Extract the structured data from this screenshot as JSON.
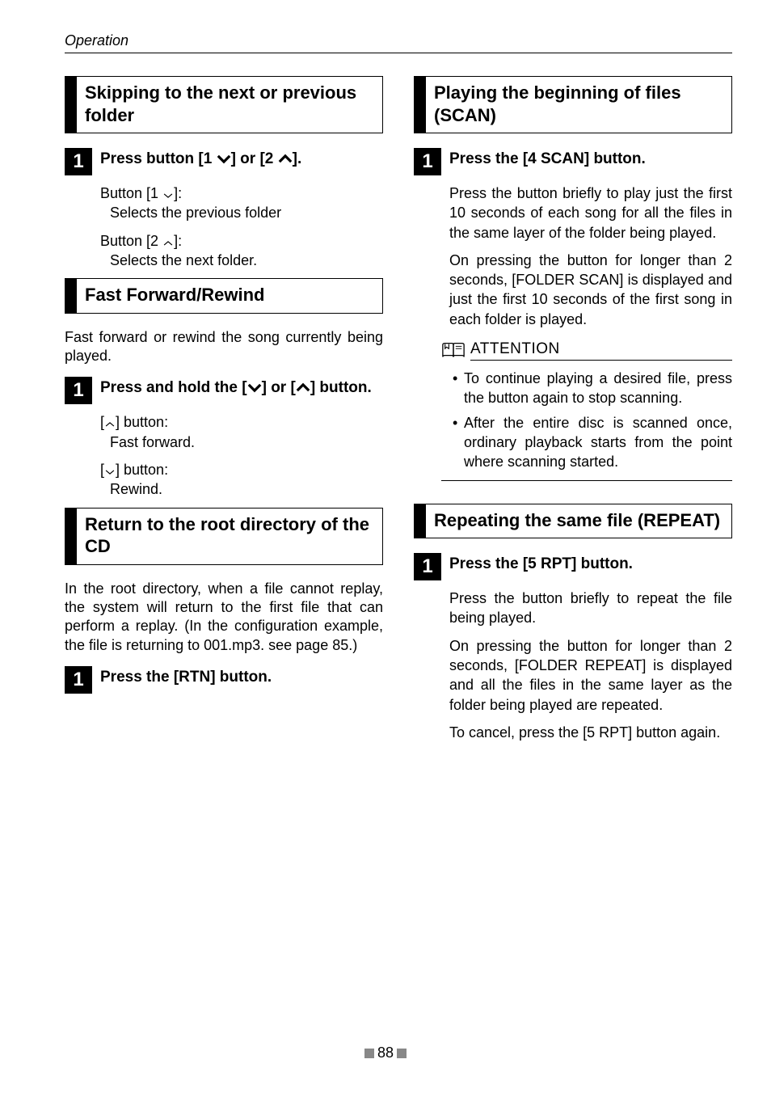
{
  "runningHead": "Operation",
  "pageNumber": "88",
  "left": {
    "sec1_title": "Skipping to the next or previous folder",
    "sec1_step_pre": "Press button [1 ",
    "sec1_step_mid": "] or [2 ",
    "sec1_step_post": "].",
    "sec1_b1a": "Button [1 ",
    "sec1_b1b": "]:",
    "sec1_b1c": "Selects the previous folder",
    "sec1_b2a": "Button [2 ",
    "sec1_b2b": "]:",
    "sec1_b2c": "Selects the next folder.",
    "sec2_title": "Fast Forward/Rewind",
    "sec2_intro": "Fast forward or rewind the song currently being played.",
    "sec2_step_pre": "Press and hold the [",
    "sec2_step_mid": "] or [",
    "sec2_step_post": "] button.",
    "sec2_b1a": "[",
    "sec2_b1b": "] button:",
    "sec2_b1c": "Fast forward.",
    "sec2_b2a": "[",
    "sec2_b2b": "] button:",
    "sec2_b2c": "Rewind.",
    "sec3_title": "Return to the root directory of the CD",
    "sec3_intro": "In the root directory, when a file cannot replay, the system will return to the first file that can perform a replay. (In the configuration example, the file is returning to 001.mp3. see page 85.)",
    "sec3_step": "Press the [RTN] button."
  },
  "right": {
    "sec4_title": "Playing the beginning of files (SCAN)",
    "sec4_step": "Press the [4 SCAN] button.",
    "sec4_p1": "Press the button briefly to play just the first 10 seconds of each song for all the files in the same layer of the folder being played.",
    "sec4_p2": "On pressing the button for longer than 2 seconds, [FOLDER SCAN] is displayed and just the first 10 seconds of the first song in each folder is played.",
    "attn_label": "ATTENTION",
    "attn_li1": "To continue playing a desired file, press the button again to stop scanning.",
    "attn_li2": "After the entire disc is scanned once, ordinary playback starts from the point where scanning started.",
    "sec5_title": "Repeating the same file (REPEAT)",
    "sec5_step": "Press the [5 RPT] button.",
    "sec5_p1": "Press the button briefly to repeat the file being played.",
    "sec5_p2": "On pressing the button for longer than 2 seconds, [FOLDER REPEAT] is displayed and all the files in the same layer as the folder being played are repeated.",
    "sec5_p3": "To cancel, press the [5 RPT] button again."
  },
  "stepNumber": "1"
}
